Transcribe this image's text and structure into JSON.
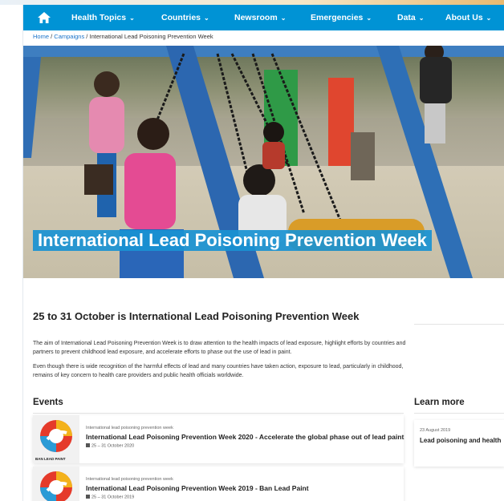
{
  "colors": {
    "nav_bg": "#0093d5",
    "hero_title_bg": "#1992d2",
    "link": "#1a73c9"
  },
  "nav": {
    "home_icon": "home-icon",
    "items": [
      {
        "label": "Health Topics",
        "icon": "chevron-down-icon"
      },
      {
        "label": "Countries",
        "icon": "chevron-down-icon"
      },
      {
        "label": "Newsroom",
        "icon": "chevron-down-icon"
      },
      {
        "label": "Emergencies",
        "icon": "chevron-down-icon"
      },
      {
        "label": "Data",
        "icon": "chevron-down-icon"
      },
      {
        "label": "About Us",
        "icon": "chevron-down-icon"
      }
    ]
  },
  "breadcrumb": {
    "home": "Home",
    "sep1": " / ",
    "campaigns": "Campaigns",
    "sep2": " / ",
    "current": "International Lead Poisoning Prevention Week"
  },
  "hero": {
    "title": "International Lead Poisoning Prevention Week"
  },
  "main": {
    "heading": "25 to 31 October is International Lead Poisoning Prevention Week",
    "paragraphs": [
      "The aim of International Lead Poisoning Prevention Week is to draw attention to the health impacts of lead exposure, highlight efforts by countries and partners to prevent childhood lead exposure, and accelerate efforts to phase out the use of lead in paint.",
      "Even though there is wide recognition of the harmful effects of lead and many countries have taken action, exposure to lead, particularly in childhood, remains of key concern to health care providers and public health officials worldwide."
    ]
  },
  "events": {
    "title": "Events",
    "items": [
      {
        "category": "International lead poisoning prevention week",
        "title": "International Lead Poisoning Prevention Week 2020 - Accelerate the global phase out of lead paint",
        "date": "25 – 31 October 2020",
        "thumb_caption": "BAN LEAD PAINT"
      },
      {
        "category": "International lead poisoning prevention week",
        "title": "International Lead Poisoning Prevention Week 2019 - Ban Lead Paint",
        "date": "25 – 31 October 2019"
      }
    ]
  },
  "learn_more": {
    "title": "Learn more",
    "items": [
      {
        "date": "23 August 2019",
        "title": "Lead poisoning and health"
      }
    ]
  }
}
